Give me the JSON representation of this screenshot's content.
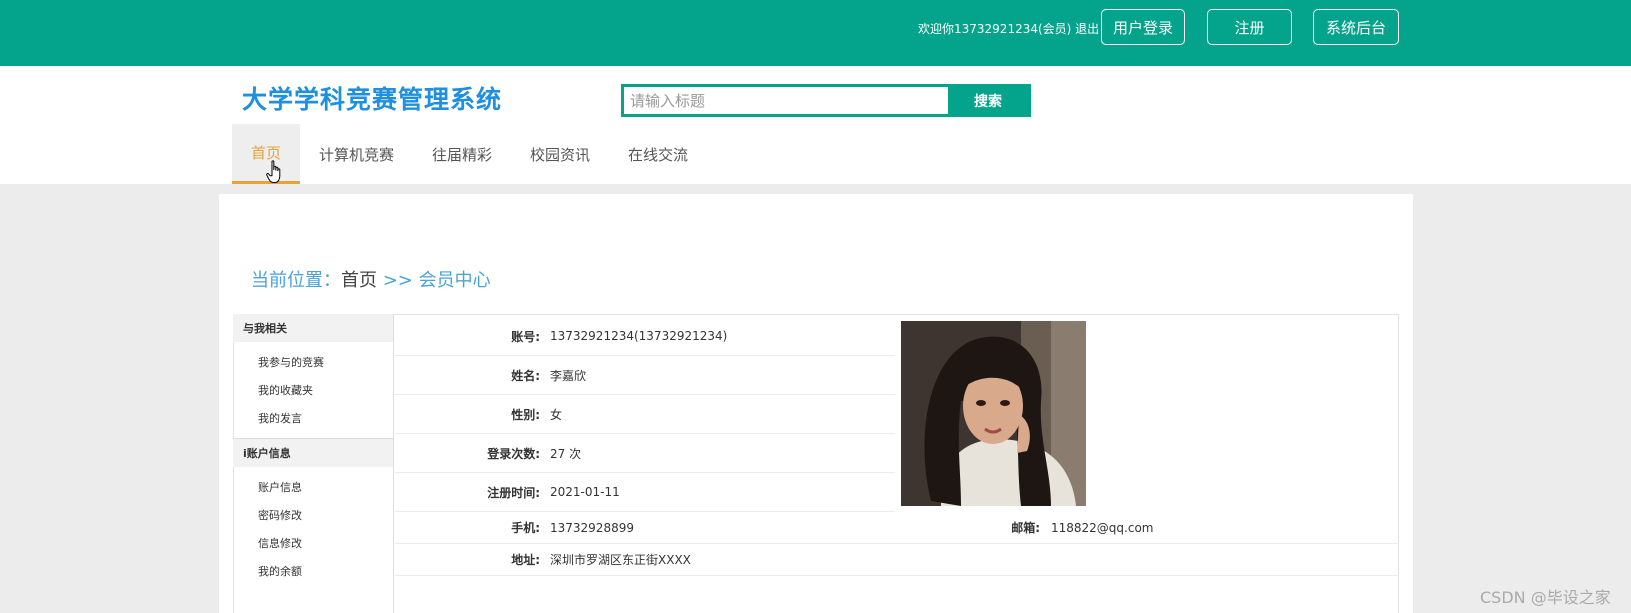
{
  "topbar": {
    "welcome": "欢迎你13732921234(会员) 退出",
    "buttons": [
      "用户登录",
      "注册",
      "系统后台"
    ]
  },
  "header": {
    "title": "大学学科竞赛管理系统",
    "search_placeholder": "请输入标题",
    "search_button": "搜索",
    "nav": [
      "首页",
      "计算机竞赛",
      "往届精彩",
      "校园资讯",
      "在线交流"
    ]
  },
  "breadcrumb": {
    "prefix": "当前位置：",
    "home": "首页",
    "sep": " >> ",
    "current": "会员中心"
  },
  "sidebar": {
    "group1": "与我相关",
    "group1_items": [
      "我参与的竞赛",
      "我的收藏夹",
      "我的发言"
    ],
    "group2": "账户信息",
    "group2_prefix": "i",
    "group2_items": [
      "账户信息",
      "密码修改",
      "信息修改",
      "我的余额"
    ]
  },
  "profile": {
    "account_label": "账号:",
    "account": "13732921234(13732921234)",
    "name_label": "姓名:",
    "name": "李嘉欣",
    "gender_label": "性别:",
    "gender": "女",
    "logins_label": "登录次数:",
    "logins": "27 次",
    "register_label": "注册时间:",
    "register": "2021-01-11",
    "phone_label": "手机:",
    "phone": "13732928899",
    "email_label": "邮箱:",
    "email": "118822@qq.com",
    "address_label": "地址:",
    "address": "深圳市罗湖区东正街XXXX"
  },
  "watermark": "CSDN @毕设之家",
  "colors": {
    "primary": "#04a48c",
    "title": "#1f8fe0",
    "nav_active": "#e8a23a",
    "breadcrumb": "#4aa3d8"
  }
}
